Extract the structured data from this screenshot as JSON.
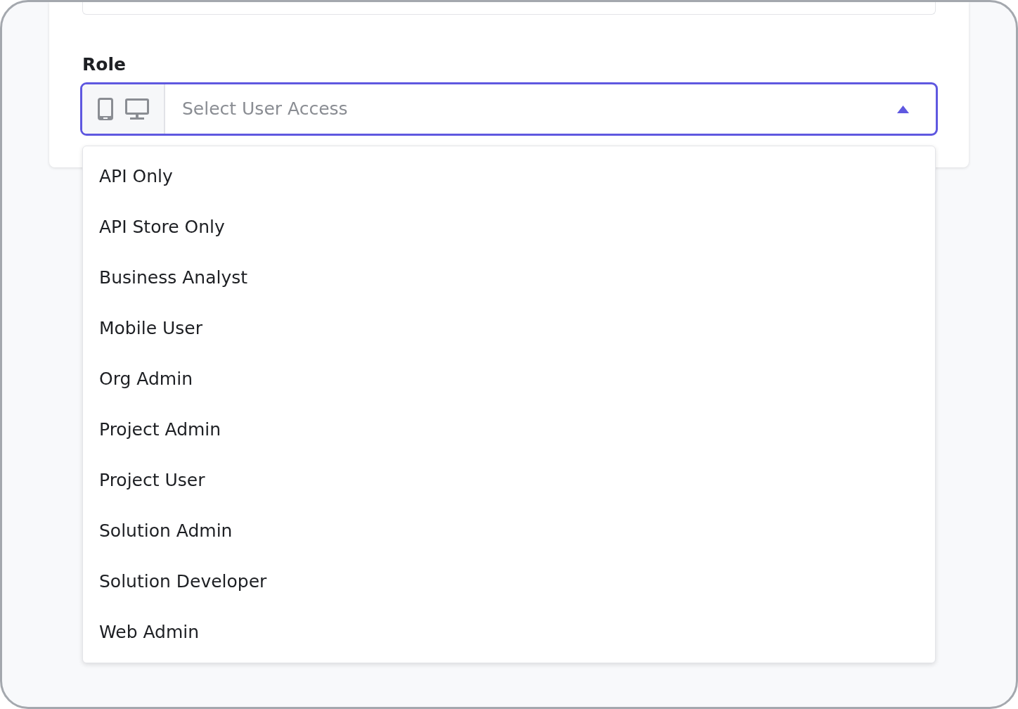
{
  "role_field": {
    "label": "Role",
    "placeholder": "Select User Access",
    "expanded": true
  },
  "options": [
    {
      "label": "API Only"
    },
    {
      "label": "API Store Only"
    },
    {
      "label": "Business Analyst"
    },
    {
      "label": "Mobile User"
    },
    {
      "label": "Org Admin"
    },
    {
      "label": "Project Admin"
    },
    {
      "label": "Project User"
    },
    {
      "label": "Solution Admin"
    },
    {
      "label": "Solution Developer"
    },
    {
      "label": "Web Admin"
    }
  ]
}
